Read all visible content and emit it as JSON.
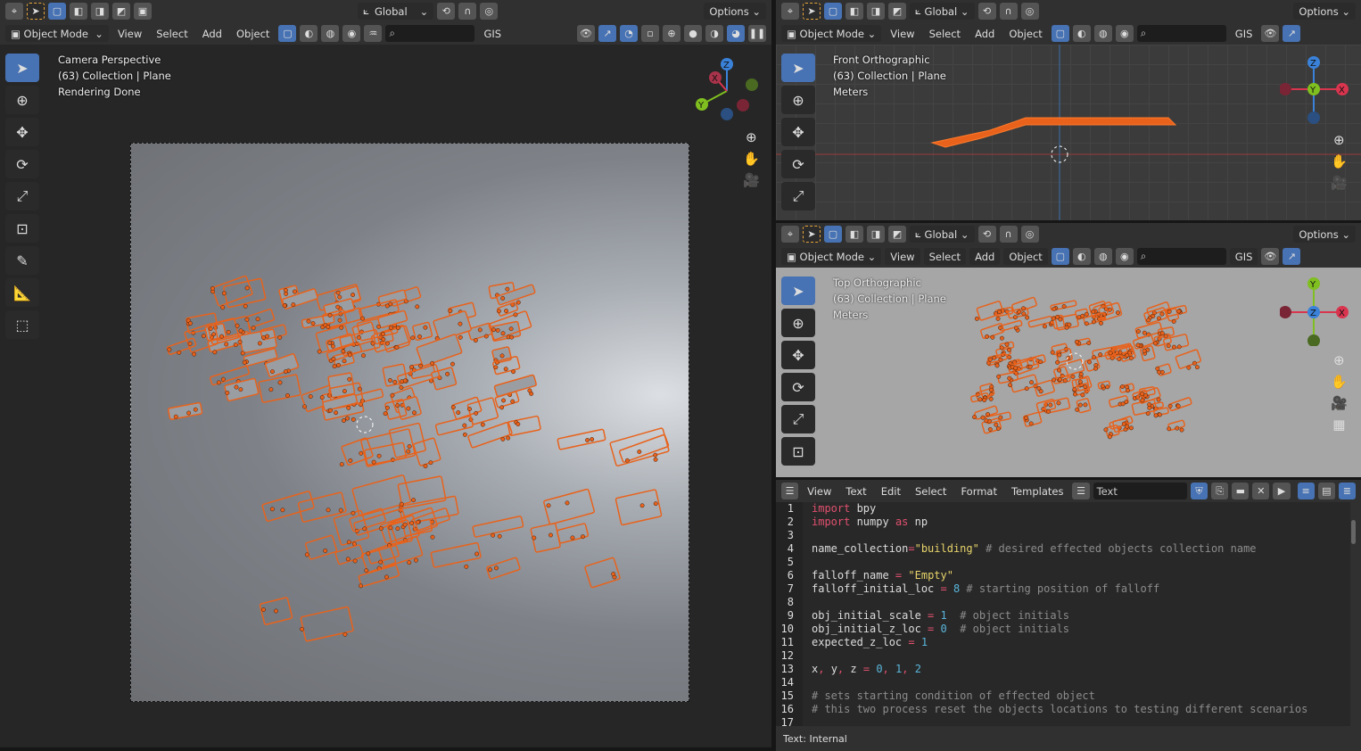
{
  "left_view": {
    "orientation": "Global",
    "options": "Options",
    "mode": "Object Mode",
    "menus": [
      "View",
      "Select",
      "Add",
      "Object"
    ],
    "gis": "GIS",
    "overlay": [
      "Camera Perspective",
      "(63) Collection | Plane",
      "Rendering Done"
    ],
    "gizmo": {
      "z": "Z",
      "x": "X",
      "y": "Y"
    }
  },
  "front_view": {
    "orientation": "Global",
    "options": "Options",
    "mode": "Object Mode",
    "menus": [
      "View",
      "Select",
      "Add",
      "Object"
    ],
    "gis": "GIS",
    "overlay": [
      "Front Orthographic",
      "(63) Collection | Plane",
      "Meters"
    ],
    "gizmo": {
      "z": "Z",
      "x": "X",
      "y": "Y"
    }
  },
  "top_view": {
    "orientation": "Global",
    "options": "Options",
    "mode": "Object Mode",
    "menus": [
      "View",
      "Select",
      "Add",
      "Object"
    ],
    "gis": "GIS",
    "overlay": [
      "Top Orthographic",
      "(63) Collection | Plane",
      "Meters"
    ],
    "gizmo": {
      "z": "Z",
      "x": "X",
      "y": "Y"
    }
  },
  "text_editor": {
    "menus": [
      "View",
      "Text",
      "Edit",
      "Select",
      "Format",
      "Templates"
    ],
    "text_name": "Text",
    "status": "Text: Internal",
    "lines": [
      [
        [
          "kw",
          "import"
        ],
        [
          "tx",
          " bpy"
        ]
      ],
      [
        [
          "kw",
          "import"
        ],
        [
          "tx",
          " numpy "
        ],
        [
          "kw",
          "as"
        ],
        [
          "tx",
          " np"
        ]
      ],
      [],
      [
        [
          "tx",
          "name_collection"
        ],
        [
          "op",
          "="
        ],
        [
          "str",
          "\"building\""
        ],
        [
          "cm",
          " # desired effected objects collection name"
        ]
      ],
      [],
      [
        [
          "tx",
          "falloff_name "
        ],
        [
          "op",
          "="
        ],
        [
          "tx",
          " "
        ],
        [
          "str",
          "\"Empty\""
        ]
      ],
      [
        [
          "tx",
          "falloff_initial_loc "
        ],
        [
          "op",
          "="
        ],
        [
          "tx",
          " "
        ],
        [
          "n",
          "8"
        ],
        [
          "cm",
          " # starting position of falloff"
        ]
      ],
      [],
      [
        [
          "tx",
          "obj_initial_scale "
        ],
        [
          "op",
          "="
        ],
        [
          "tx",
          " "
        ],
        [
          "n",
          "1"
        ],
        [
          "cm",
          "  # object initials"
        ]
      ],
      [
        [
          "tx",
          "obj_initial_z_loc "
        ],
        [
          "op",
          "="
        ],
        [
          "tx",
          " "
        ],
        [
          "n",
          "0"
        ],
        [
          "cm",
          "  # object initials"
        ]
      ],
      [
        [
          "tx",
          "expected_z_loc "
        ],
        [
          "op",
          "="
        ],
        [
          "tx",
          " "
        ],
        [
          "n",
          "1"
        ]
      ],
      [],
      [
        [
          "tx",
          "x"
        ],
        [
          "op",
          ","
        ],
        [
          "tx",
          " y"
        ],
        [
          "op",
          ","
        ],
        [
          "tx",
          " z "
        ],
        [
          "op",
          "="
        ],
        [
          "tx",
          " "
        ],
        [
          "n",
          "0"
        ],
        [
          "op",
          ","
        ],
        [
          "tx",
          " "
        ],
        [
          "n",
          "1"
        ],
        [
          "op",
          ","
        ],
        [
          "tx",
          " "
        ],
        [
          "n",
          "2"
        ]
      ],
      [],
      [
        [
          "cm",
          "# sets starting condition of effected object"
        ]
      ],
      [
        [
          "cm",
          "# this two process reset the objects locations to testing different scenarios"
        ]
      ],
      []
    ]
  },
  "colors": {
    "accent": "#4772b3",
    "selection": "#ff6a1a",
    "axis_x": "#d9354f",
    "axis_y": "#7fbf1f",
    "axis_z": "#3a82d9"
  }
}
